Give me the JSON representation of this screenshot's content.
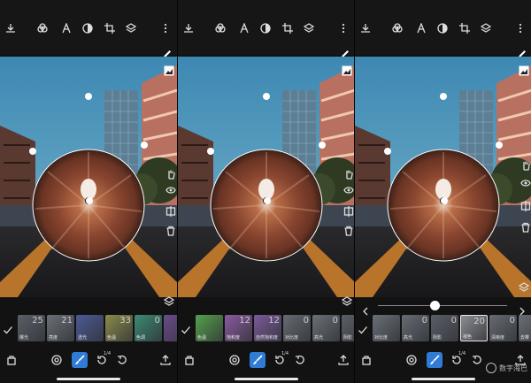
{
  "screens": [
    {
      "chips": [
        {
          "value": "25",
          "label": "曝光",
          "color": "#5a5e66"
        },
        {
          "value": "21",
          "label": "亮度",
          "color": "#6a6e76"
        },
        {
          "value": "",
          "label": "透光",
          "color": "#4c5a96"
        },
        {
          "value": "33",
          "label": "色温",
          "color": "#8a8a4a"
        },
        {
          "value": "0",
          "label": "色调",
          "color": "#3c8a72"
        },
        {
          "value": "",
          "label": "",
          "color": "#6a4a8a"
        }
      ]
    },
    {
      "chips": [
        {
          "value": "",
          "label": "色温",
          "color": "#56a04c"
        },
        {
          "value": "12",
          "label": "饱和度",
          "color": "#8a5aa0"
        },
        {
          "value": "12",
          "label": "自然饱和度",
          "color": "#7a5a9a"
        },
        {
          "value": "0",
          "label": "对比度",
          "color": "#666a72"
        },
        {
          "value": "0",
          "label": "高光",
          "color": "#6a6e76"
        },
        {
          "value": "",
          "label": "阴影",
          "color": "#5a5e66"
        }
      ]
    },
    {
      "chips": [
        {
          "value": "",
          "label": "对比度",
          "color": "#6a6e76"
        },
        {
          "value": "0",
          "label": "高光",
          "color": "#666a72"
        },
        {
          "value": "0",
          "label": "阴影",
          "color": "#5a5e66"
        },
        {
          "value": "20",
          "label": "褪色",
          "color": "#8a8d92"
        },
        {
          "value": "0",
          "label": "清晰度",
          "color": "#666a72"
        },
        {
          "value": "0",
          "label": "去雾",
          "color": "#6a6e76"
        }
      ],
      "slider_value": 0.44
    }
  ],
  "badge": "1/4",
  "watermark": "数字海巴",
  "colors": {
    "accent": "#2f7bd6",
    "sky": "#4f93b8",
    "mask": "#a05a3a"
  },
  "icons": [
    "download-icon",
    "palette-icon",
    "text-icon",
    "mask-icon",
    "crop-icon",
    "layers-icon",
    "more-icon"
  ]
}
